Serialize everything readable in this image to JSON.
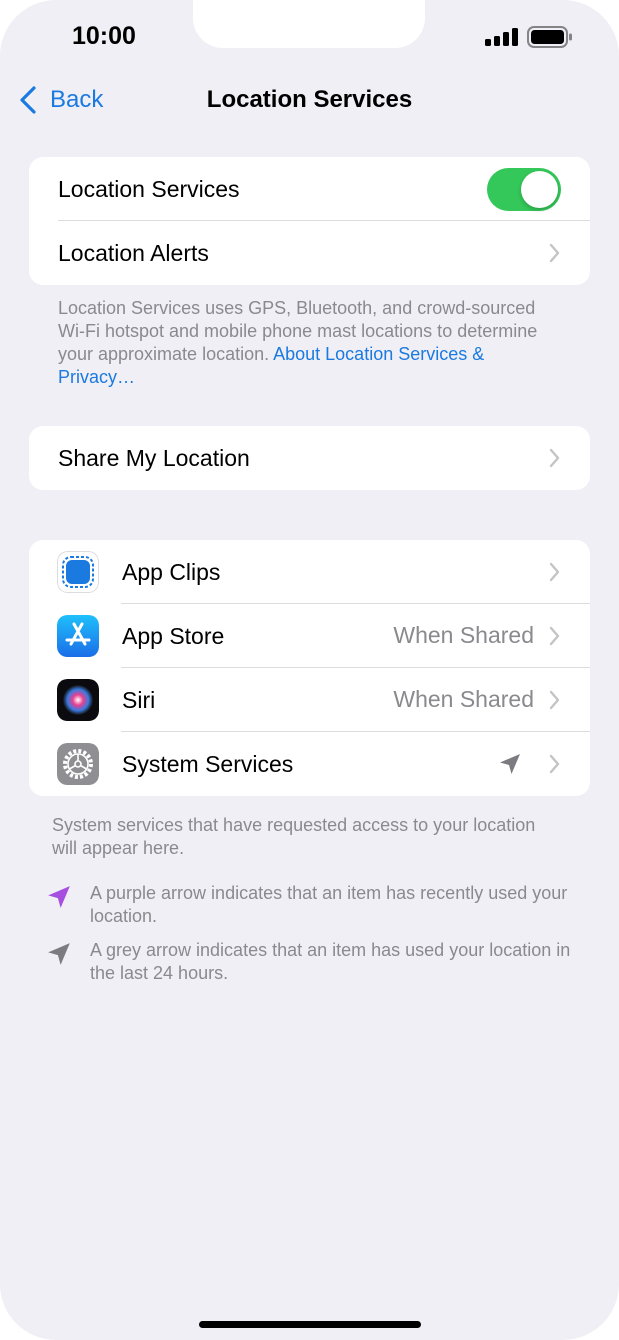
{
  "status_bar": {
    "time": "10:00"
  },
  "nav": {
    "back_label": "Back",
    "title": "Location Services"
  },
  "group1": {
    "location_services_label": "Location Services",
    "location_services_on": true,
    "location_alerts_label": "Location Alerts"
  },
  "footer1": {
    "text": "Location Services uses GPS, Bluetooth, and crowd-sourced Wi-Fi hotspot and mobile phone mast locations to determine your approximate location. ",
    "link": "About Location Services & Privacy…"
  },
  "group2": {
    "share_label": "Share My Location"
  },
  "apps": [
    {
      "name": "App Clips",
      "icon": "app-clips-icon",
      "value": ""
    },
    {
      "name": "App Store",
      "icon": "app-store-icon",
      "value": "When Shared"
    },
    {
      "name": "Siri",
      "icon": "siri-icon",
      "value": "When Shared"
    },
    {
      "name": "System Services",
      "icon": "settings-gear-icon",
      "value": ""
    }
  ],
  "footer2": {
    "text": "System services that have requested access to your location will appear here."
  },
  "legend": [
    {
      "text": "A purple arrow indicates that an item has recently used your location.",
      "color": "#a54ee0"
    },
    {
      "text": "A grey arrow indicates that an item has used your location in the last 24 hours.",
      "color": "#7c7c80"
    }
  ],
  "colors": {
    "accent": "#1a7ae0",
    "toggle_on": "#34c759",
    "background": "#f0eff5"
  }
}
